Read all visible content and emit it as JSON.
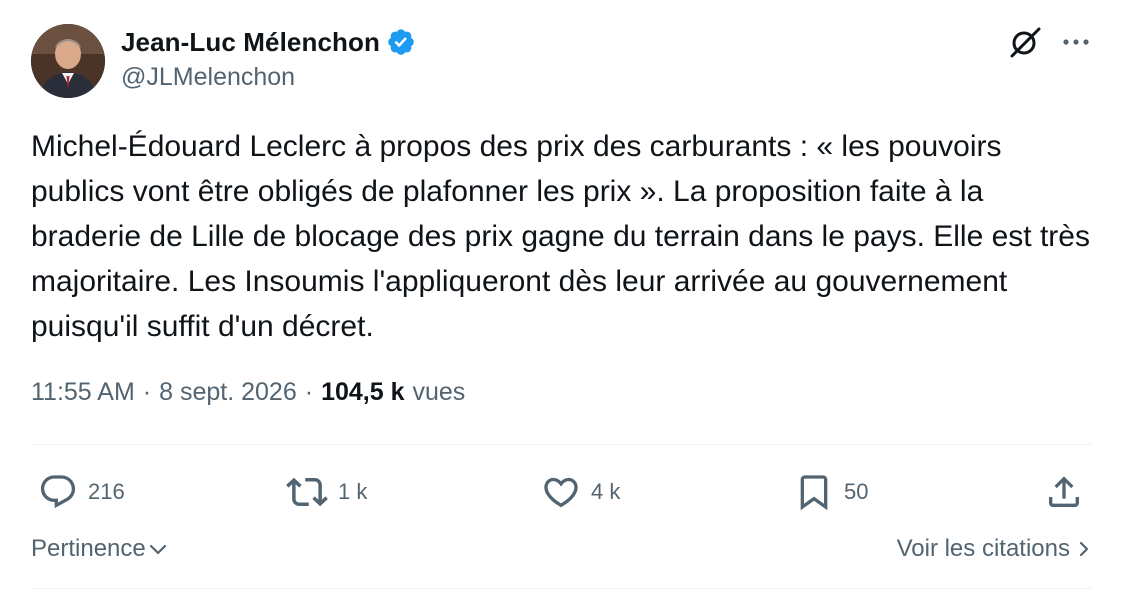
{
  "author": {
    "name": "Jean-Luc Mélenchon",
    "handle": "@JLMelenchon",
    "verified_color": "#1d9bf0"
  },
  "tweet": {
    "text": "Michel-Édouard Leclerc à propos des prix des carburants : « les pouvoirs publics vont être obligés de plafonner les prix ». La proposition faite à la braderie de Lille de blocage des prix gagne du terrain dans le pays. Elle est très majoritaire. Les Insoumis l'appliqueront dès leur arrivée au gouvernement puisqu'il suffit d'un décret.",
    "time": "11:55 AM",
    "date": "8 sept. 2026",
    "views_count": "104,5 k",
    "views_label": "vues",
    "separator": "·"
  },
  "actions": {
    "replies": "216",
    "reposts": "1 k",
    "likes": "4 k",
    "bookmarks": "50"
  },
  "footer": {
    "sort_label": "Pertinence",
    "quotes_label": "Voir les citations"
  },
  "icons": {
    "reply": "reply-bubble-icon",
    "repost": "repost-arrows-icon",
    "like": "heart-icon",
    "bookmark": "bookmark-icon",
    "share": "share-upload-icon",
    "grok": "grok-icon",
    "more": "more-dots-icon",
    "verified": "verified-badge-icon"
  },
  "colors": {
    "text_primary": "#0f1419",
    "text_secondary": "#536471",
    "divider": "#eff3f4",
    "accent": "#1d9bf0"
  }
}
